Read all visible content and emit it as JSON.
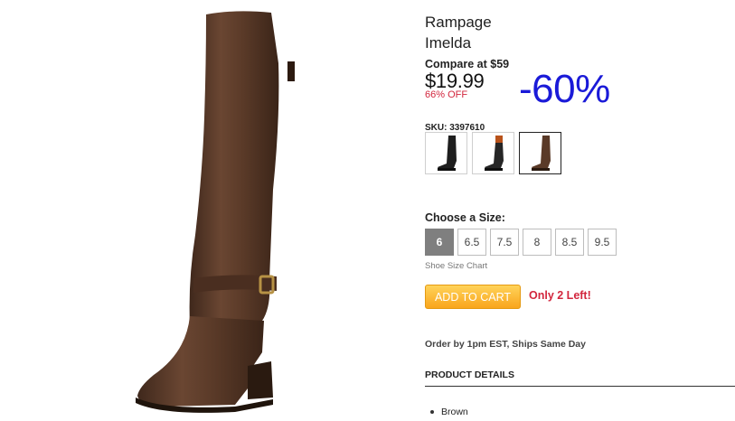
{
  "product": {
    "brand": "Rampage",
    "model": "Imelda",
    "compare_at": "Compare at $59",
    "price": "$19.99",
    "percent_off": "66% OFF",
    "discount_badge": "-60%",
    "sku": "SKU: 3397610"
  },
  "swatches": [
    {
      "color_name": "black",
      "boot_color": "#1e1e1e",
      "accent": "#1e1e1e"
    },
    {
      "color_name": "black-tan",
      "boot_color": "#262626",
      "accent": "#b8521a"
    },
    {
      "color_name": "brown",
      "boot_color": "#5a3a28",
      "accent": "#5a3a28"
    }
  ],
  "selected_swatch": 2,
  "sizes": {
    "label": "Choose a Size:",
    "options": [
      "6",
      "6.5",
      "7.5",
      "8",
      "8.5",
      "9.5"
    ],
    "selected": "6",
    "chart_link": "Shoe Size Chart"
  },
  "cart": {
    "button": "ADD TO CART",
    "stock": "Only 2 Left!"
  },
  "shipping": "Order by 1pm EST, Ships Same Day",
  "details": {
    "title": "PRODUCT DETAILS",
    "items": [
      "Brown"
    ]
  },
  "colors": {
    "boot": "#5b3b2a",
    "discount": "#1a1ad8",
    "sale_red": "#d2263d",
    "cart_orange": "#f9a51c"
  }
}
